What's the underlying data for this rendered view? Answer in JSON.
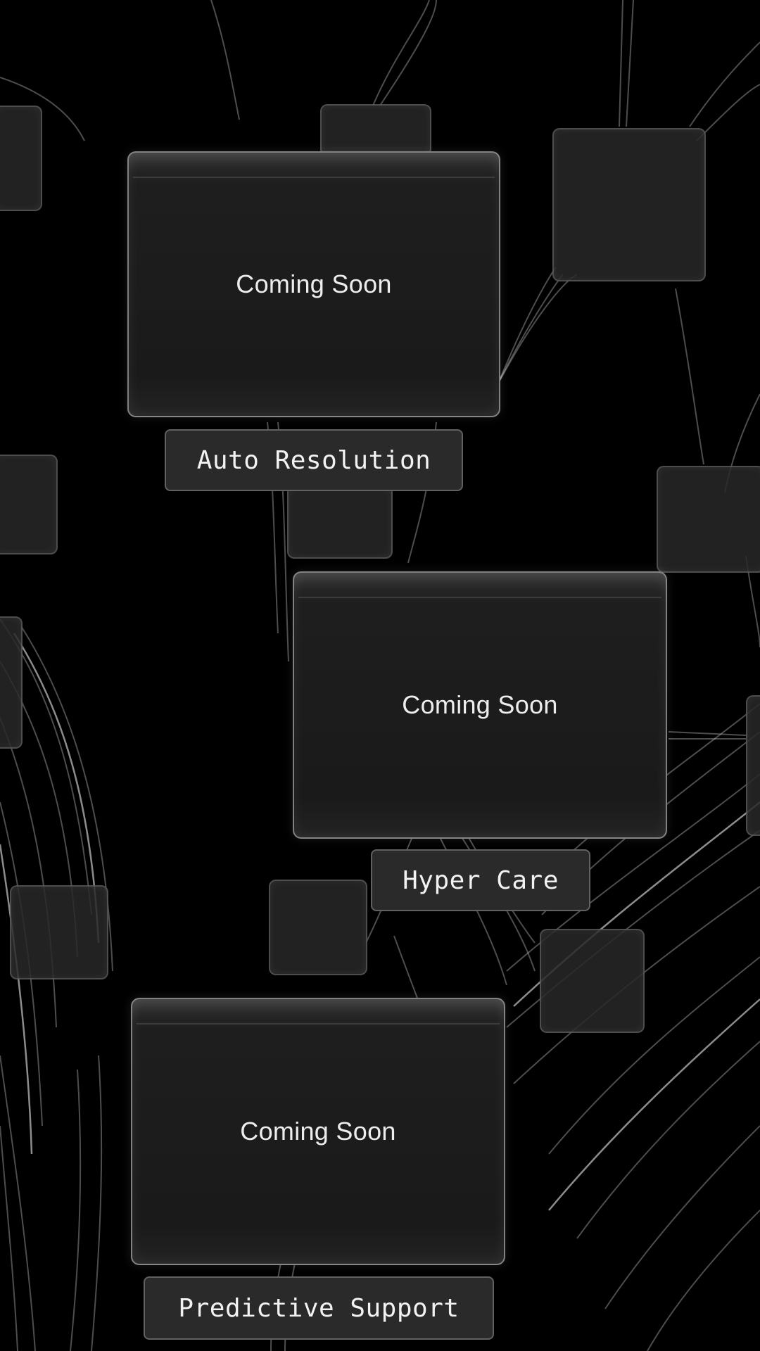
{
  "cards": [
    {
      "status": "Coming Soon",
      "label": "Auto Resolution"
    },
    {
      "status": "Coming Soon",
      "label": "Hyper Care"
    },
    {
      "status": "Coming Soon",
      "label": "Predictive Support"
    }
  ],
  "colors": {
    "background": "#000000",
    "card_fill": "#1c1c1c",
    "card_border": "#bdbdbd",
    "label_fill": "#2a2a2a",
    "text": "#eeeeee"
  }
}
